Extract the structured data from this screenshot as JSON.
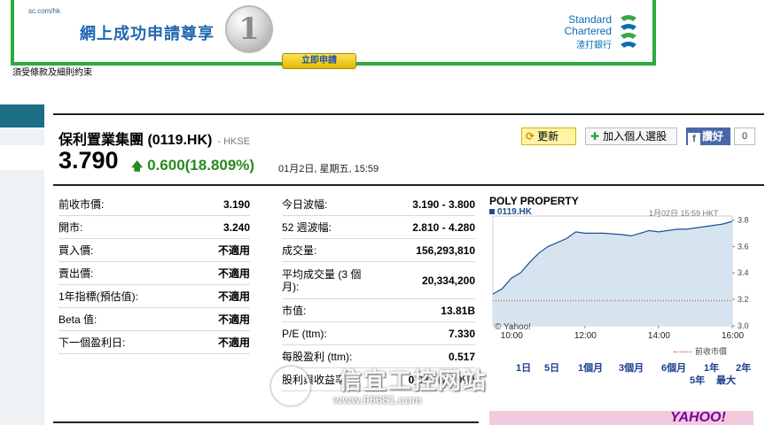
{
  "banner": {
    "url": "sc.com/hk",
    "promo": "網上成功申請尊享",
    "coin_value": "1",
    "apply_button": "立即申請",
    "brand_line1": "Standard",
    "brand_line2": "Chartered",
    "brand_chinese": "渣打銀行",
    "terms": "須受條款及細則約束",
    "colors": {
      "border": "#2eaa3f",
      "promo": "#1f67b1"
    }
  },
  "quote": {
    "company": "保利置業集團 (0119.HK)",
    "exchange": "- HKSE",
    "price": "3.790",
    "change": "0.600(18.809%)",
    "timestamp": "01月2日, 星期五, 15:59",
    "change_color": "#2a8a1f"
  },
  "actions": {
    "refresh": "更新",
    "add_portfolio": "加入個人選股",
    "facebook": "讚好",
    "facebook_count": "0"
  },
  "stats_left": [
    {
      "label": "前收市價:",
      "value": "3.190"
    },
    {
      "label": "開市:",
      "value": "3.240"
    },
    {
      "label": "買入價:",
      "value": "不適用"
    },
    {
      "label": "賣出價:",
      "value": "不適用"
    },
    {
      "label": "1年指標(預估值):",
      "value": "不適用"
    },
    {
      "label": "Beta 值:",
      "value": "不適用"
    },
    {
      "label": "下一個盈利日:",
      "value": "不適用"
    }
  ],
  "stats_right": [
    {
      "label": "今日波幅:",
      "value": "3.190 - 3.800"
    },
    {
      "label": "52 週波幅:",
      "value": "2.810 - 4.280"
    },
    {
      "label": "成交量:",
      "value": "156,293,810"
    },
    {
      "label": "平均成交量 (3 個月):",
      "value": "20,334,200"
    },
    {
      "label": "市值:",
      "value": "13.81B"
    },
    {
      "label": "P/E (ttm):",
      "value": "7.330"
    },
    {
      "label": "每股盈利 (ttm):",
      "value": "0.517"
    },
    {
      "label": "股利與收益率",
      "value": "0.223 (7.20%)"
    }
  ],
  "chart_data": {
    "type": "area",
    "title": "POLY PROPERTY",
    "symbol": "0119.HK",
    "date_label": "1月02日 15:59 HKT",
    "credit": "© Yahoo!",
    "legend": "前收市價",
    "x_ticks": [
      "10:00",
      "12:00",
      "14:00",
      "16:00"
    ],
    "y_ticks": [
      "3.8",
      "3.6",
      "3.4",
      "3.2",
      "3.0"
    ],
    "ylim": [
      3.0,
      3.83
    ],
    "prev_close": 3.19,
    "x": [
      9.5,
      9.75,
      10.0,
      10.25,
      10.5,
      10.75,
      11.0,
      11.25,
      11.5,
      11.75,
      12.0,
      12.5,
      13.0,
      13.25,
      13.5,
      13.75,
      14.0,
      14.25,
      14.5,
      14.75,
      15.0,
      15.25,
      15.5,
      15.75,
      16.0
    ],
    "values": [
      3.24,
      3.28,
      3.36,
      3.4,
      3.48,
      3.55,
      3.6,
      3.63,
      3.66,
      3.71,
      3.7,
      3.7,
      3.69,
      3.68,
      3.7,
      3.72,
      3.71,
      3.72,
      3.73,
      3.73,
      3.74,
      3.75,
      3.76,
      3.77,
      3.79
    ],
    "colors": {
      "line": "#1f4f96",
      "fill": "#d6e4f0",
      "prev": "#c0442a"
    }
  },
  "ranges": [
    {
      "label": "1日"
    },
    {
      "label": "5日"
    },
    {
      "label": "1個月"
    },
    {
      "label": "3個月"
    },
    {
      "label": "6個月"
    },
    {
      "label": "1年"
    },
    {
      "label": "2年"
    },
    {
      "label": "5年"
    },
    {
      "label": "最大"
    }
  ],
  "ad": {
    "brand": "YAHOO!"
  },
  "watermark": {
    "text": "信宜工控网站",
    "url": "www.06681.com"
  }
}
